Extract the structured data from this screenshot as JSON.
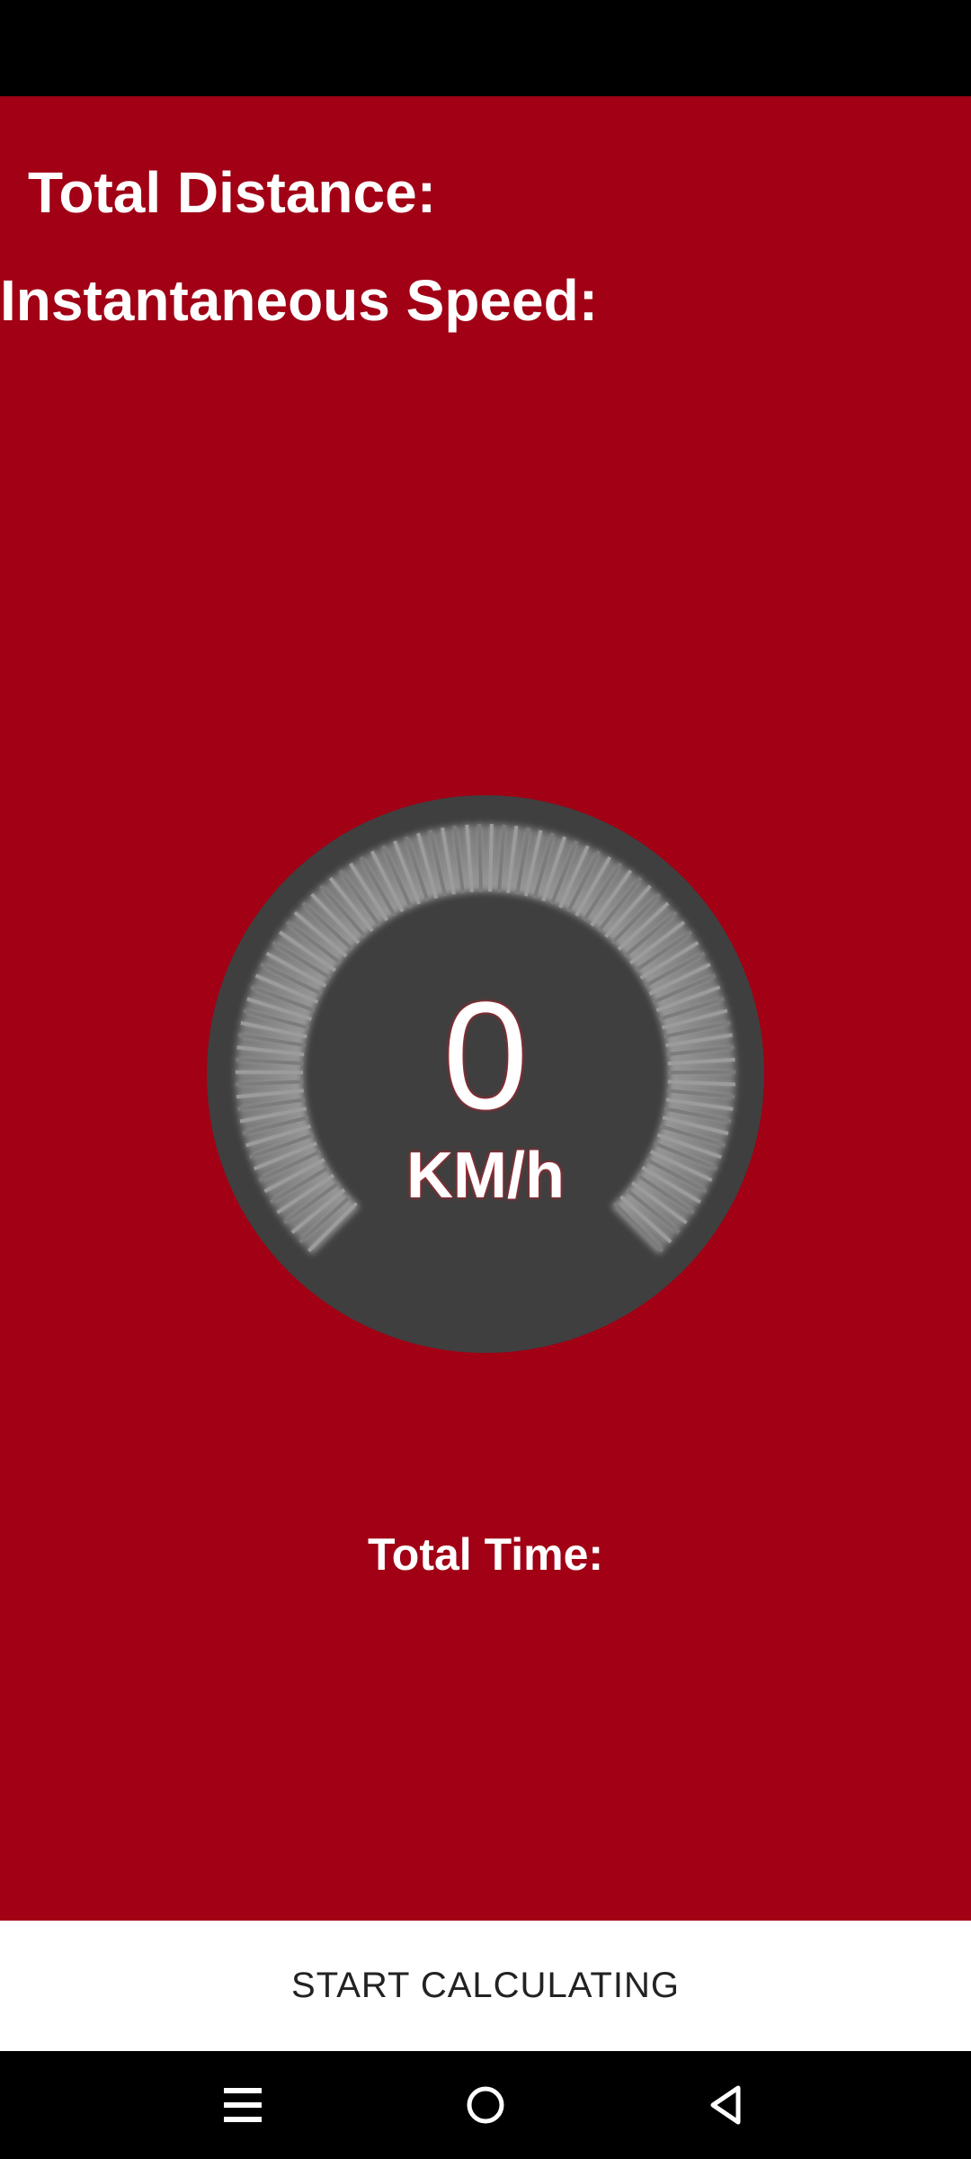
{
  "colors": {
    "background": "#A10015",
    "gauge_face": "#3F3F3F",
    "tick": "#8A8A8A",
    "text": "#FFFFFF",
    "status_bar": "#000000",
    "action_bar": "#FFFFFF"
  },
  "labels": {
    "total_distance": "Total Distance:",
    "instantaneous_speed": "Instantaneous Speed:",
    "total_time": "Total Time:"
  },
  "speedometer": {
    "value": "0",
    "unit": "KM/h"
  },
  "action": {
    "start_label": "START CALCULATING"
  },
  "nav": {
    "menu_icon": "menu-icon",
    "home_icon": "home-icon",
    "back_icon": "back-icon"
  }
}
